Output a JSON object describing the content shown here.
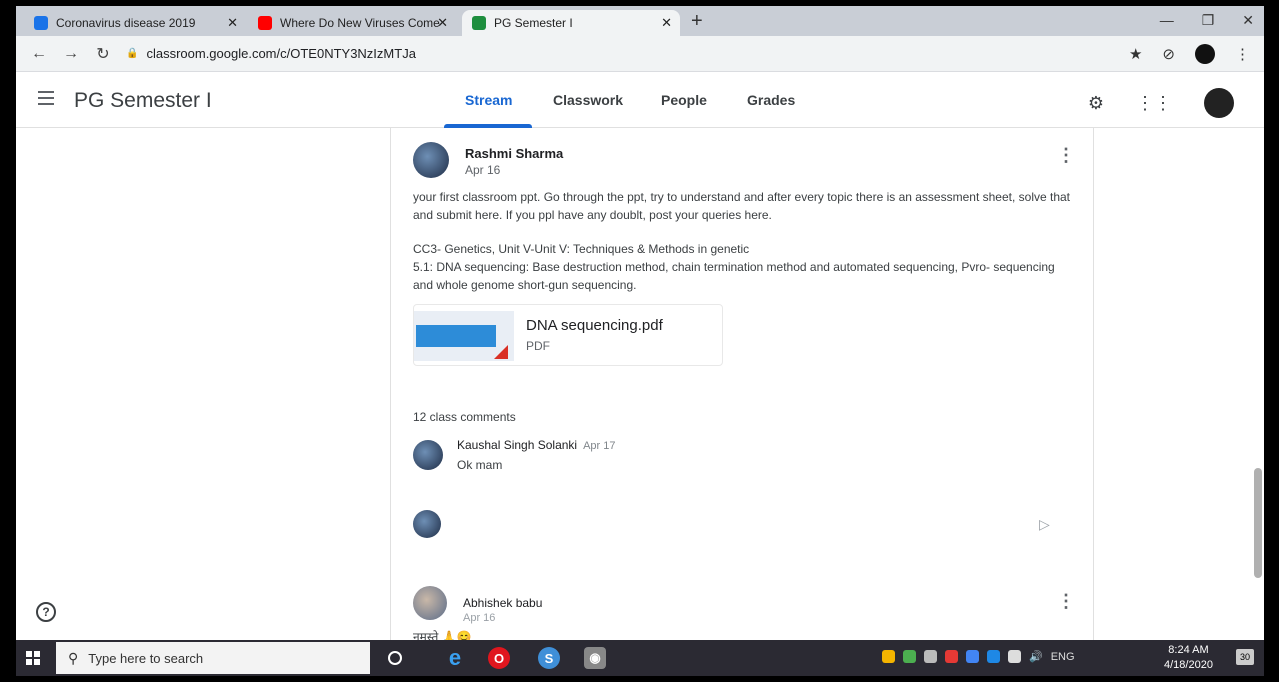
{
  "browser": {
    "tabs": [
      {
        "title": "Coronavirus disease 2019",
        "color": "#1a73e8"
      },
      {
        "title": "Where Do New Viruses Come Fré",
        "color": "#ff0000"
      },
      {
        "title": "PG Semester I",
        "color": "#1e8e3e"
      }
    ],
    "new_tab_glyph": "+",
    "url": "classroom.google.com/c/OTE0NTY3NzIzMTJa"
  },
  "classroom": {
    "class_title": "PG Semester I",
    "nav_tabs": [
      "Stream",
      "Classwork",
      "People",
      "Grades"
    ],
    "active_tab": "Stream"
  },
  "post": {
    "author": "Rashmi Sharma",
    "date": "Apr 16",
    "paragraph1_line1": "your first classroom ppt. Go through the ppt, try to understand and after every topic there is an assessment sheet, solve that",
    "paragraph1_line2": "and submit here. If you ppl have any doublt, post your queries here.",
    "paragraph2_line1": "CC3- Genetics, Unit V-Unit V: Techniques & Methods in genetic",
    "paragraph2_line2": "5.1: DNA sequencing: Base destruction method, chain termination method and automated sequencing, Pvro- sequencing",
    "paragraph2_line3": "and whole genome short-gun sequencing.",
    "attachment": {
      "name": "DNA sequencing.pdf",
      "type": "PDF"
    },
    "comments_count": "12 class comments",
    "comment": {
      "author": "Kaushal Singh Solanki",
      "date": "Apr 17",
      "text": "Ok mam"
    }
  },
  "next_post": {
    "author": "Abhishek babu",
    "date": "Apr 16",
    "text": "नमस्ते 🙏😊"
  },
  "taskbar": {
    "search_placeholder": "Type here to search",
    "lang": "ENG",
    "time": "8:24 AM",
    "date": "4/18/2020",
    "notification_count": "30"
  }
}
